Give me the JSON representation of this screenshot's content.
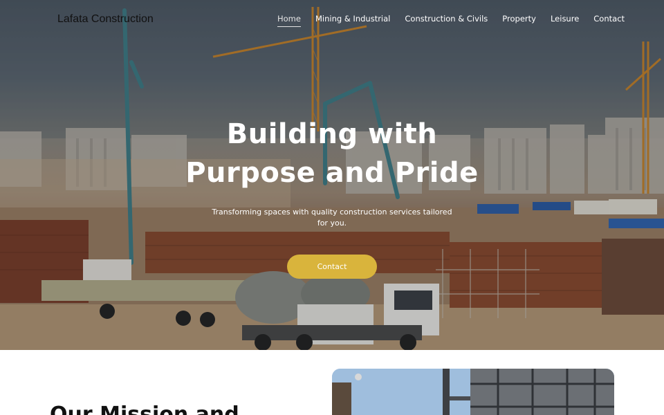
{
  "brand": {
    "name": "Lafata Construction"
  },
  "nav": {
    "items": [
      {
        "label": "Home",
        "active": true
      },
      {
        "label": "Mining & Industrial",
        "active": false
      },
      {
        "label": "Construction & Civils",
        "active": false
      },
      {
        "label": "Property",
        "active": false
      },
      {
        "label": "Leisure",
        "active": false
      },
      {
        "label": "Contact",
        "active": false
      }
    ]
  },
  "hero": {
    "title_line1": "Building with",
    "title_line2": "Purpose and Pride",
    "subtitle": "Transforming spaces with quality construction services tailored for you.",
    "cta_label": "Contact",
    "image_icon": "construction-site-photo"
  },
  "mission": {
    "title": "Our Mission and",
    "image_icon": "building-frame-photo"
  },
  "colors": {
    "accent": "#d9b43c",
    "hero_text": "#ffffff",
    "brand_text": "#111111"
  }
}
